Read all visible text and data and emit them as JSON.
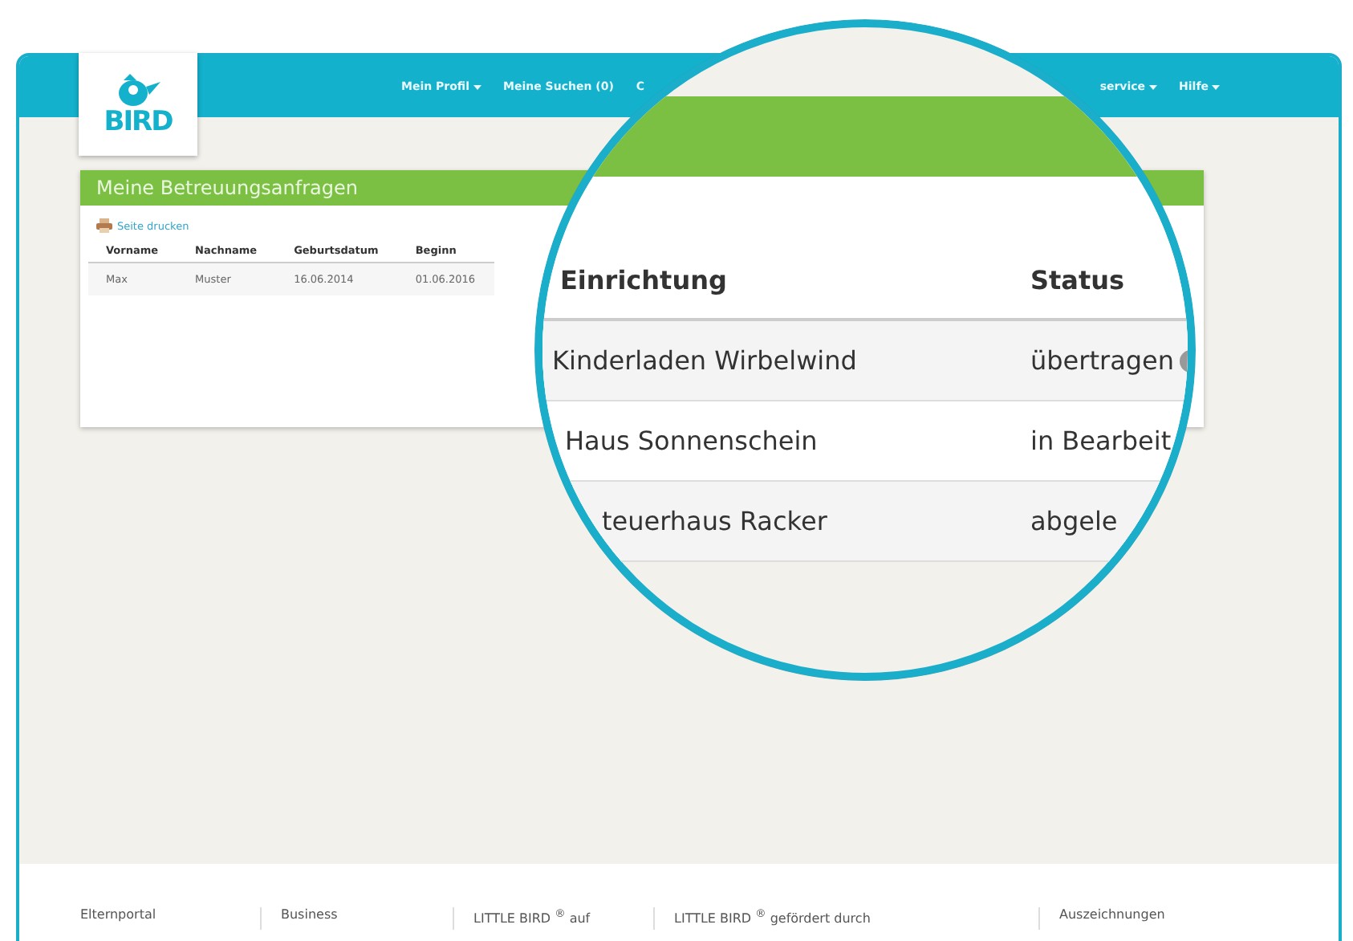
{
  "logo": {
    "text": "BIRD"
  },
  "nav": [
    {
      "label": "Mein Profil",
      "dropdown": true
    },
    {
      "label": "Meine Suchen (0)",
      "dropdown": false
    },
    {
      "label": "C",
      "dropdown": false
    },
    {
      "label": "service",
      "dropdown": true
    },
    {
      "label": "Hilfe",
      "dropdown": true
    }
  ],
  "card": {
    "title": "Meine Betreuungsanfragen",
    "print_link": "Seite drucken",
    "columns": [
      "Vorname",
      "Nachname",
      "Geburtsdatum",
      "Beginn"
    ],
    "rows": [
      [
        "Max",
        "Muster",
        "16.06.2014",
        "01.06.2016"
      ]
    ]
  },
  "magnifier": {
    "columns": [
      "Einrichtung",
      "Status"
    ],
    "rows": [
      {
        "facility": "Kinderladen Wirbelwind",
        "status": "übertragen",
        "info": true
      },
      {
        "facility": "Haus Sonnenschein",
        "status": "in Bearbeit",
        "info": false
      },
      {
        "facility": "teuerhaus Racker",
        "status": "abgele",
        "info": false
      }
    ]
  },
  "footer": [
    "Elternportal",
    "Business",
    "LITTLE BIRD $^{®}$ auf",
    "LITTLE BIRD $^{®}$ gefördert durch",
    "Auszeichnungen"
  ]
}
